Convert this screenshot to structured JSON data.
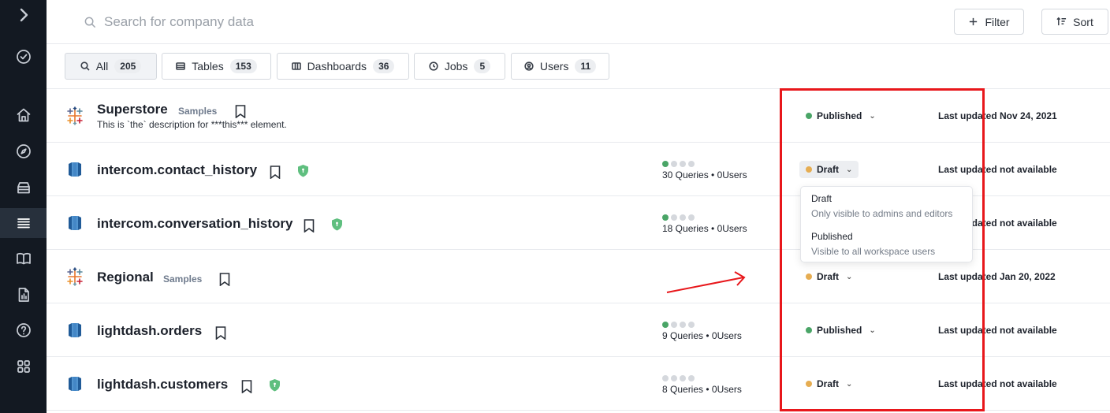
{
  "sidebar": {
    "items": [
      {
        "icon": "chevron-right-icon"
      },
      {
        "icon": "check-circle-icon"
      },
      {
        "icon": "home-icon"
      },
      {
        "icon": "compass-icon"
      },
      {
        "icon": "database-icon"
      },
      {
        "icon": "list-icon",
        "active": true
      },
      {
        "icon": "book-icon"
      },
      {
        "icon": "report-icon"
      },
      {
        "icon": "help-icon"
      },
      {
        "icon": "apps-grid-icon"
      }
    ]
  },
  "search": {
    "placeholder": "Search for company data"
  },
  "toolbar": {
    "filter_label": "Filter",
    "sort_label": "Sort"
  },
  "tabs": [
    {
      "label": "All",
      "count": "205",
      "icon": "search-icon",
      "active": true
    },
    {
      "label": "Tables",
      "count": "153",
      "icon": "table-icon"
    },
    {
      "label": "Dashboards",
      "count": "36",
      "icon": "dashboard-icon"
    },
    {
      "label": "Jobs",
      "count": "5",
      "icon": "clock-icon"
    },
    {
      "label": "Users",
      "count": "11",
      "icon": "user-icon"
    }
  ],
  "rows": [
    {
      "title": "Superstore",
      "tag": "Samples",
      "description": "This is `the` description for ***this*** element.",
      "icon": "tableau-icon",
      "status": "Published",
      "updated": "Last updated Nov 24, 2021"
    },
    {
      "title": "intercom.contact_history",
      "icon": "redshift-icon",
      "verified": true,
      "usage_level": 1,
      "usage": "30 Queries • 0Users",
      "status": "Draft",
      "updated": "Last updated not available"
    },
    {
      "title": "intercom.conversation_history",
      "icon": "redshift-icon",
      "verified": true,
      "usage_level": 1,
      "usage": "18 Queries • 0Users",
      "status": "Draft",
      "updated": "Last updated not available"
    },
    {
      "title": "Regional",
      "tag": "Samples",
      "icon": "tableau-icon",
      "status": "Draft",
      "updated": "Last updated Jan 20, 2022"
    },
    {
      "title": "lightdash.orders",
      "icon": "redshift-icon",
      "usage_level": 1,
      "usage": "9 Queries • 0Users",
      "status": "Published",
      "updated": "Last updated not available"
    },
    {
      "title": "lightdash.customers",
      "icon": "redshift-icon",
      "verified": true,
      "usage_level": 0,
      "usage": "8 Queries • 0Users",
      "status": "Draft",
      "updated": "Last updated not available"
    }
  ],
  "dropdown": {
    "options": [
      {
        "title": "Draft",
        "description": "Only visible to admins and editors"
      },
      {
        "title": "Published",
        "description": "Visible to all workspace users"
      }
    ]
  },
  "colors": {
    "published": "#4aa567",
    "draft": "#e6ad52",
    "annotation": "#e8171b",
    "sidebar": "#131922"
  }
}
